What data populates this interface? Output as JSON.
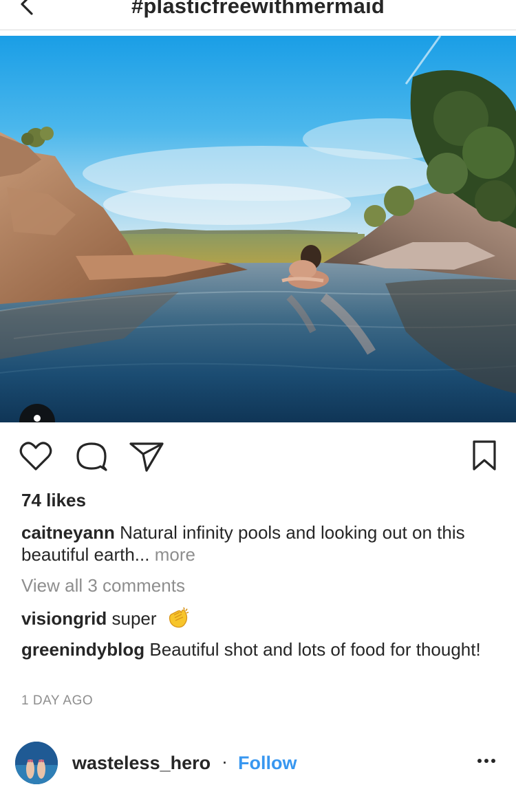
{
  "header": {
    "title": "#plasticfreewithmermaid"
  },
  "post": {
    "likes": "74 likes",
    "caption": {
      "username": "caitneyann",
      "text": "Natural infinity pools and looking out on this beautiful earth...",
      "more": "more"
    },
    "view_comments": "View all 3 comments",
    "comments": [
      {
        "username": "visiongrid",
        "text": "super"
      },
      {
        "username": "greenindyblog",
        "text": "Beautiful shot and lots of food for thought!"
      }
    ],
    "timestamp": "1 DAY AGO"
  },
  "next_post": {
    "username": "wasteless_hero",
    "separator": "·",
    "follow_label": "Follow"
  },
  "colors": {
    "link_blue": "#3897f0",
    "muted_gray": "#8e8e8e",
    "text": "#262626"
  },
  "icons": {
    "back": "chevron-left-icon",
    "like": "heart-icon",
    "comment": "speech-bubble-icon",
    "share": "paper-plane-icon",
    "save": "bookmark-icon",
    "tag": "user-tag-icon",
    "emoji": "clapping-hands-icon",
    "more": "ellipsis-icon"
  }
}
